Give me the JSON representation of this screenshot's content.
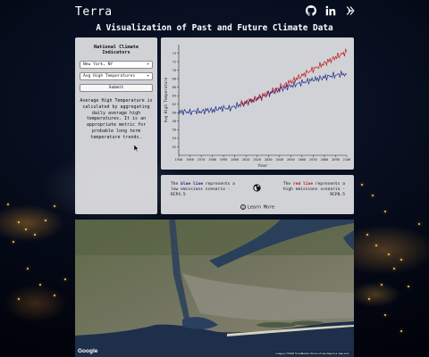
{
  "header": {
    "brand": "Terra",
    "title": "A Visualization of Past and Future Climate Data",
    "social_icons": [
      "github-icon",
      "linkedin-icon",
      "devpost-icon"
    ]
  },
  "controls": {
    "heading": "National Climate Indicators",
    "location_value": "New York, NY",
    "indicator_value": "Avg High Temperatures",
    "submit_label": "Submit",
    "description": "Average High Temperature is calculated by aggregating daily average high temperatures. It is an appropriate metric for probable long term temperature trends."
  },
  "legend": {
    "left_prefix": "The ",
    "left_color_word": "blue line",
    "left_suffix": " represents a low emissions scenario - RCP4.5",
    "right_prefix": "The ",
    "right_color_word": "red line",
    "right_suffix": " represents a high emissions scenario - RCP8.5",
    "learn_more": "Learn More"
  },
  "map": {
    "logo": "Google",
    "attribution": "Imagery ©2020 TerraMetrics   Terms of Use   Report a map error"
  },
  "colors": {
    "low_emissions": "#1a2a8a",
    "high_emissions": "#c01818"
  },
  "chart_data": {
    "type": "line",
    "xlabel": "Year",
    "ylabel": "Avg High Temperature",
    "xlim": [
      1950,
      2100
    ],
    "ylim": [
      50,
      76
    ],
    "x_ticks": [
      1950,
      1960,
      1970,
      1980,
      1990,
      2000,
      2010,
      2020,
      2030,
      2040,
      2050,
      2060,
      2070,
      2080,
      2090,
      2100
    ],
    "y_ticks": [
      52,
      54,
      56,
      58,
      60,
      62,
      64,
      66,
      68,
      70,
      72,
      74
    ],
    "series": [
      {
        "name": "RCP4.5",
        "color": "#1a2a8a",
        "x": [
          1950,
          1955,
          1960,
          1965,
          1970,
          1975,
          1980,
          1985,
          1990,
          1995,
          2000,
          2005,
          2010,
          2015,
          2020,
          2025,
          2030,
          2035,
          2040,
          2045,
          2050,
          2055,
          2060,
          2065,
          2070,
          2075,
          2080,
          2085,
          2090,
          2095,
          2100
        ],
        "values": [
          60.0,
          60.3,
          60.1,
          60.4,
          60.2,
          60.6,
          60.5,
          60.9,
          61.1,
          61.0,
          61.5,
          61.9,
          62.3,
          62.8,
          63.3,
          63.8,
          64.4,
          64.9,
          65.4,
          65.9,
          66.3,
          66.7,
          67.1,
          67.4,
          67.8,
          68.0,
          68.3,
          68.6,
          68.8,
          69.1,
          69.0
        ]
      },
      {
        "name": "RCP8.5",
        "color": "#c01818",
        "x": [
          2005,
          2010,
          2015,
          2020,
          2025,
          2030,
          2035,
          2040,
          2045,
          2050,
          2055,
          2060,
          2065,
          2070,
          2075,
          2080,
          2085,
          2090,
          2095,
          2100
        ],
        "values": [
          62.0,
          62.4,
          62.9,
          63.4,
          64.0,
          64.6,
          65.3,
          65.9,
          66.6,
          67.3,
          68.0,
          68.7,
          69.5,
          70.2,
          70.9,
          71.6,
          72.3,
          73.0,
          73.7,
          74.3
        ]
      }
    ]
  }
}
